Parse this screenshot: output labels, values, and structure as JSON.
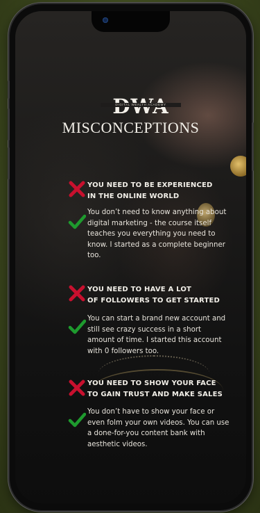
{
  "logo": {
    "letters": "DWA",
    "tagline": "DIGITAL WEALTH ACADEMY"
  },
  "title": "MISCONCEPTIONS",
  "items": [
    {
      "myth": "YOU NEED TO BE EXPERIENCED\nIN THE ONLINE WORLD",
      "truth": "You don’t need to know anything about digital marketing - the course itself teaches you everything you need to know. I started as a complete beginner too."
    },
    {
      "myth": "YOU NEED TO HAVE A LOT\nOF FOLLOWERS TO GET STARTED",
      "truth": "You can start a brand new account and still see crazy success in a short amount of time. I started this account with 0 followers too."
    },
    {
      "myth": "YOU NEED TO SHOW YOUR FACE\nTO GAIN TRUST AND MAKE SALES",
      "truth": "You don’t have to show your face or even folm your own videos. You can use a done-for-you content bank with aesthetic videos."
    }
  ],
  "icons": {
    "myth": "red-x-icon",
    "truth": "green-checkmark-icon"
  },
  "colors": {
    "background": "#3e4a1f",
    "cross": "#c8102e",
    "check": "#1e9a2e",
    "text": "#f2efe8"
  }
}
